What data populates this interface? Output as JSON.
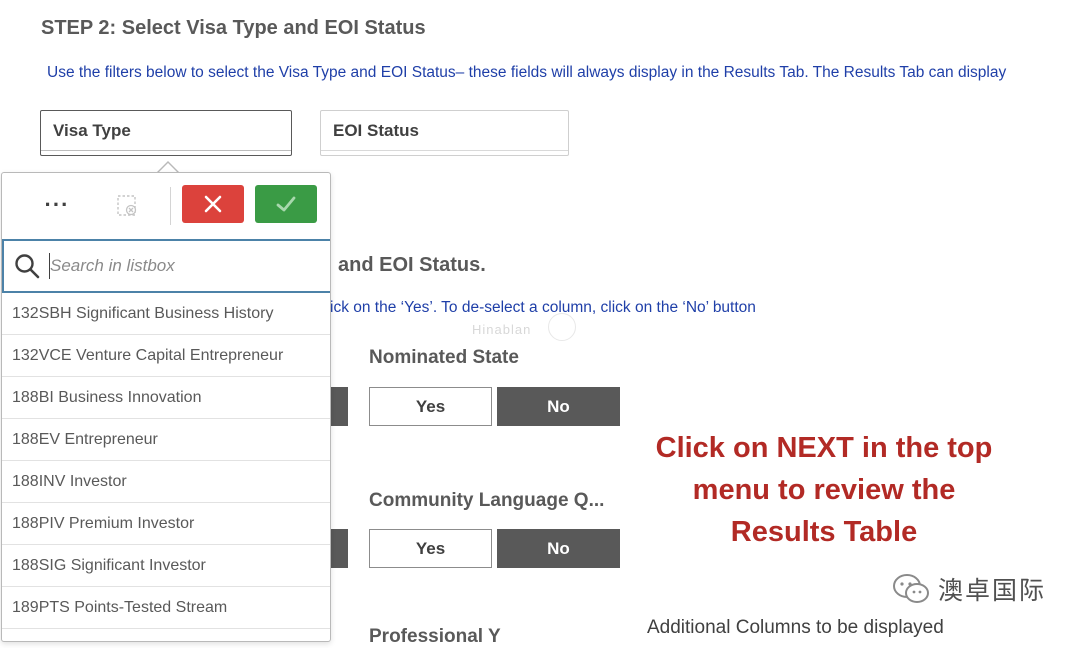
{
  "step2": {
    "title": "STEP 2: Select Visa Type and EOI Status",
    "instruction": "Use the filters below to select the Visa Type and EOI Status– these fields will always display in the Results Tab. The Results Tab can display"
  },
  "filters": {
    "visa_type_label": "Visa Type",
    "eoi_status_label": "EOI Status"
  },
  "popover": {
    "more_label": "···",
    "search_placeholder": "Search in listbox",
    "items": [
      "132SBH Significant Business History",
      "132VCE Venture Capital Entrepreneur",
      "188BI Business Innovation",
      "188EV Entrepreneur",
      "188INV Investor",
      "188PIV Premium Investor",
      "188SIG Significant Investor",
      "189PTS Points-Tested Stream"
    ],
    "colors": {
      "cancel": "#dc423c",
      "confirm": "#3a9b45",
      "search_border": "#4c82a8"
    },
    "icons": [
      "more-icon",
      "clear-selections-icon",
      "close-icon",
      "check-icon",
      "search-icon"
    ]
  },
  "step3": {
    "title_fragment": "and EOI Status.",
    "text_fragment": "ick on the ‘Yes’. To de-select a column, click on the ‘No’ button",
    "watermark_small": "Hinablan"
  },
  "nominated_state": {
    "title": "Nominated State",
    "yes_label": "Yes",
    "no_label": "No"
  },
  "community_language": {
    "title": "Community Language Q...",
    "yes_label": "Yes",
    "no_label": "No"
  },
  "professional_fragment": "Professional Y",
  "cta": {
    "line1": "Click on NEXT in the top",
    "line2": "menu to review the",
    "line3": "Results Table",
    "color": "#b22a25"
  },
  "additional_fragment": "Additional Columns to be displayed",
  "brand_watermark": {
    "text": "澳卓国际",
    "icon": "wechat-icon"
  }
}
